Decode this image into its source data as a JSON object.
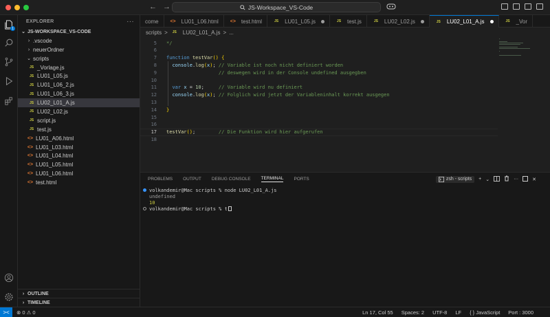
{
  "window": {
    "search": "JS-Workspace_VS-Code",
    "nav_back": "←",
    "nav_forward": "→"
  },
  "activity": {
    "badge": "1"
  },
  "sidebar": {
    "title": "EXPLORER",
    "more": "···",
    "root": "JS-WORKSPACE_VS-CODE",
    "items": [
      {
        "label": ".vscode",
        "kind": "folder-closed",
        "indent": 1
      },
      {
        "label": "neuerOrdner",
        "kind": "folder-closed",
        "indent": 1
      },
      {
        "label": "scripts",
        "kind": "folder-open",
        "indent": 1
      },
      {
        "label": "_Vorlage.js",
        "kind": "js",
        "indent": 2
      },
      {
        "label": "LU01_L05.js",
        "kind": "js",
        "indent": 2
      },
      {
        "label": "LU01_L06_2.js",
        "kind": "js",
        "indent": 2
      },
      {
        "label": "LU01_L06_3.js",
        "kind": "js",
        "indent": 2
      },
      {
        "label": "LU02_L01_A.js",
        "kind": "js",
        "indent": 2,
        "selected": true
      },
      {
        "label": "LU02_L02.js",
        "kind": "js",
        "indent": 2
      },
      {
        "label": "script.js",
        "kind": "js",
        "indent": 2
      },
      {
        "label": "test.js",
        "kind": "js",
        "indent": 2
      },
      {
        "label": "LU01_A06.html",
        "kind": "html",
        "indent": 1
      },
      {
        "label": "LU01_L03.html",
        "kind": "html",
        "indent": 1
      },
      {
        "label": "LU01_L04.html",
        "kind": "html",
        "indent": 1
      },
      {
        "label": "LU01_L05.html",
        "kind": "html",
        "indent": 1
      },
      {
        "label": "LU01_L06.html",
        "kind": "html",
        "indent": 1
      },
      {
        "label": "test.html",
        "kind": "html",
        "indent": 1
      }
    ],
    "outline": "OUTLINE",
    "timeline": "TIMELINE",
    "js_badge": "JS",
    "html_badge": "<>"
  },
  "tabs": [
    {
      "label": "come",
      "icon": "",
      "modified": false,
      "active": false
    },
    {
      "label": "LU01_L06.html",
      "icon": "<>",
      "modified": false,
      "active": false
    },
    {
      "label": "test.html",
      "icon": "<>",
      "modified": false,
      "active": false
    },
    {
      "label": "LU01_L05.js",
      "icon": "JS",
      "modified": true,
      "active": false
    },
    {
      "label": "test.js",
      "icon": "JS",
      "modified": false,
      "active": false
    },
    {
      "label": "LU02_L02.js",
      "icon": "JS",
      "modified": true,
      "active": false
    },
    {
      "label": "LU02_L01_A.js",
      "icon": "JS",
      "modified": true,
      "active": true
    },
    {
      "label": "_Vor",
      "icon": "JS",
      "modified": false,
      "active": false
    }
  ],
  "breadcrumb": {
    "folder": "scripts",
    "sep": ">",
    "file_icon": "JS",
    "file": "LU02_L01_A.js",
    "more": "..."
  },
  "code": [
    {
      "n": "5",
      "text": "*/"
    },
    {
      "n": "6",
      "text": ""
    },
    {
      "n": "7",
      "text": "function testVar() {"
    },
    {
      "n": "8",
      "text": "  console.log(x); // Variable ist noch nicht definiert worden"
    },
    {
      "n": "9",
      "text": "                  // deswegen wird in der Console undefined ausgegben"
    },
    {
      "n": "10",
      "text": ""
    },
    {
      "n": "11",
      "text": "  var x = 10;     // Variable wird nu definiert"
    },
    {
      "n": "12",
      "text": "  console.log(x); // Folglich wird jetzt der Variableninhalt korrekt ausgegen"
    },
    {
      "n": "13",
      "text": ""
    },
    {
      "n": "14",
      "text": "}"
    },
    {
      "n": "15",
      "text": ""
    },
    {
      "n": "16",
      "text": ""
    },
    {
      "n": "17",
      "text": "testVar();        // Die Funktion wird hier aufgerufen"
    },
    {
      "n": "18",
      "text": ""
    }
  ],
  "panel": {
    "tabs": [
      "PROBLEMS",
      "OUTPUT",
      "DEBUG CONSOLE",
      "TERMINAL",
      "PORTS"
    ],
    "active_tab": "TERMINAL",
    "terminal_name": "zsh - scripts",
    "add": "+",
    "more": "···"
  },
  "terminal": {
    "lines": [
      {
        "prompt": "volkandemir@Mac scripts % ",
        "cmd": "node LU02_L01_A.js"
      },
      {
        "output": "undefined"
      },
      {
        "output": "10"
      },
      {
        "prompt": "volkandemir@Mac scripts % ",
        "cmd": "t"
      }
    ]
  },
  "status": {
    "remote": "><",
    "problems": "⊗ 0 ⚠ 0",
    "position": "Ln 17, Col 55",
    "spaces": "Spaces: 2",
    "encoding": "UTF-8",
    "eol": "LF",
    "language": "{ } JavaScript",
    "port": "Port : 3000"
  },
  "colors": {
    "accent": "#0078d4",
    "js": "#cbcb41",
    "html": "#e37933"
  }
}
